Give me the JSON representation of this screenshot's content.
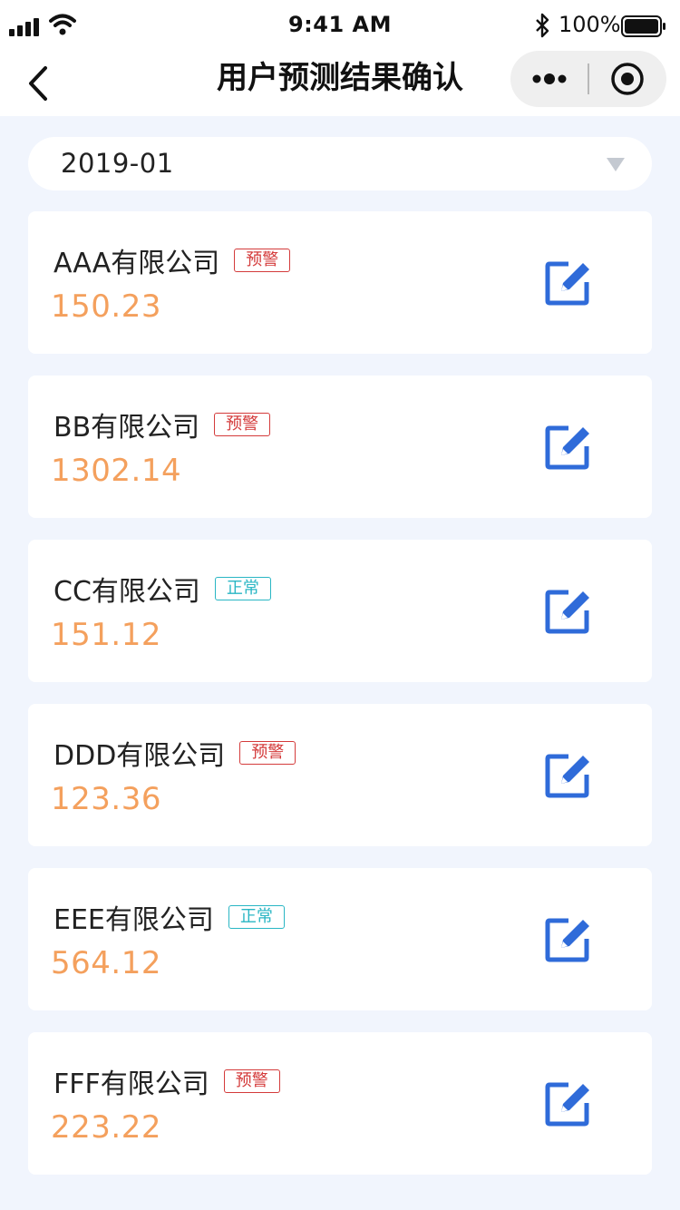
{
  "status_bar": {
    "time": "9:41 AM",
    "battery": "100%"
  },
  "nav": {
    "title": "用户预测结果确认"
  },
  "month_select": {
    "value": "2019-01"
  },
  "colors": {
    "warning": "#d43b3b",
    "normal": "#29b6c4",
    "amount": "#f4a05d",
    "edit_icon": "#2f6bd9",
    "background": "#f1f5fd"
  },
  "companies": [
    {
      "name": "AAA有限公司",
      "status": "预警",
      "status_type": "warning",
      "amount": "150.23"
    },
    {
      "name": "BB有限公司",
      "status": "预警",
      "status_type": "warning",
      "amount": "1302.14"
    },
    {
      "name": "CC有限公司",
      "status": "正常",
      "status_type": "normal",
      "amount": "151.12"
    },
    {
      "name": "DDD有限公司",
      "status": "预警",
      "status_type": "warning",
      "amount": "123.36"
    },
    {
      "name": "EEE有限公司",
      "status": "正常",
      "status_type": "normal",
      "amount": "564.12"
    },
    {
      "name": "FFF有限公司",
      "status": "预警",
      "status_type": "warning",
      "amount": "223.22"
    }
  ]
}
